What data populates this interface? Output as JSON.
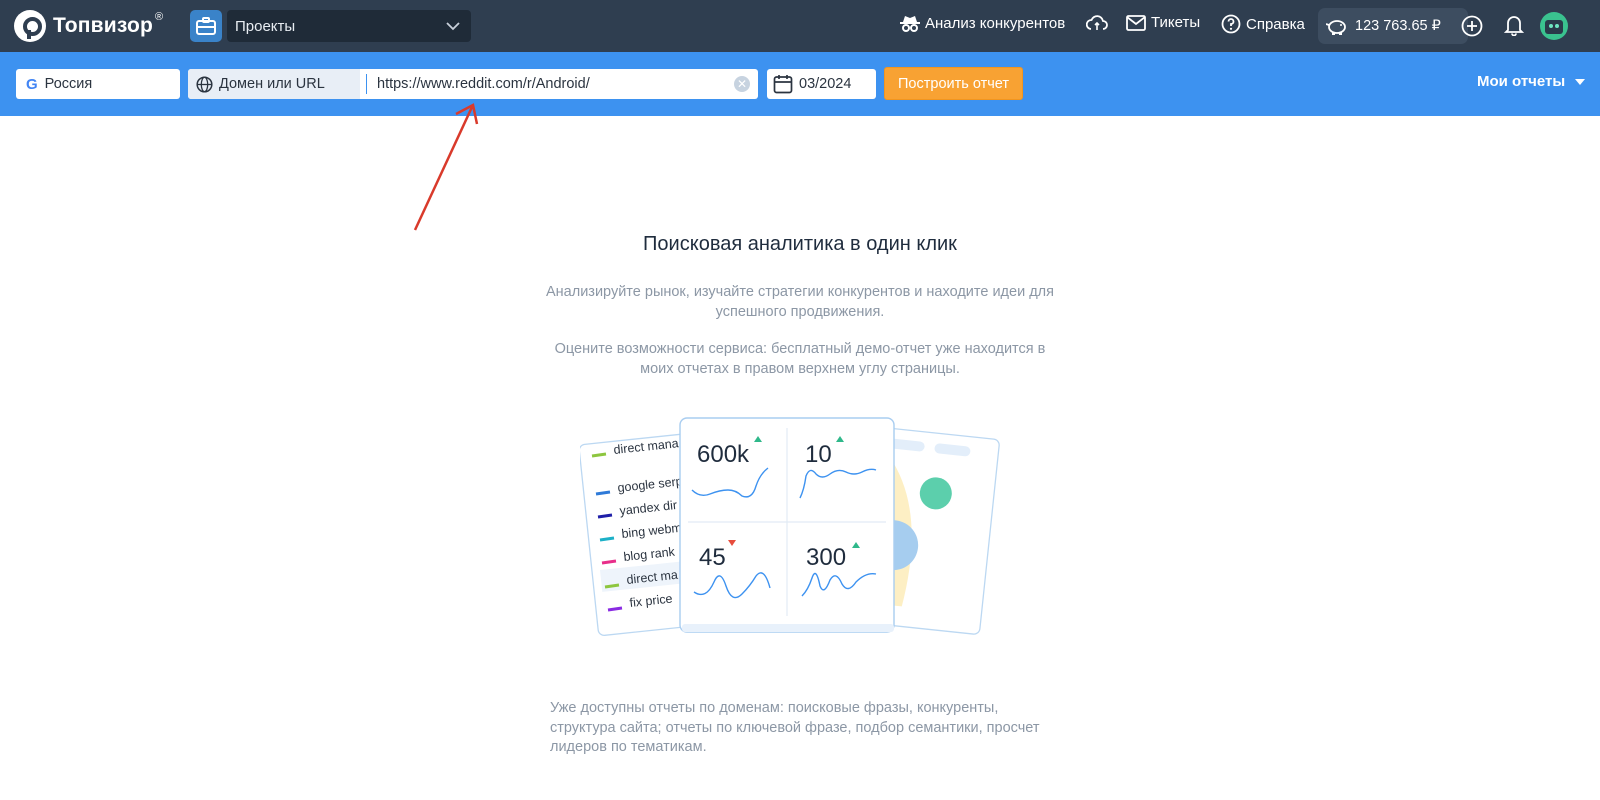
{
  "app": {
    "brand": "Топвизор",
    "brand_mark": "®",
    "brand_icon": "topvisor-logo-icon"
  },
  "nav": {
    "projects_label": "Проекты",
    "competitors": "Анализ конкурентов",
    "tickets": "Тикеты",
    "help": "Справка",
    "balance": "123 763.65 ₽"
  },
  "search": {
    "region": "Россия",
    "engine_icon": "google-icon",
    "type_label": "Домен или URL",
    "url_value": "https://www.reddit.com/r/Android/",
    "date": "03/2024",
    "build_button": "Построить отчет",
    "my_reports": "Мои отчеты"
  },
  "main": {
    "headline": "Поисковая аналитика в один клик",
    "desc1": "Анализируйте рынок, изучайте стратегии конкурентов и находите идеи для успешного продвижения.",
    "desc2": "Оцените возможности сервиса: бесплатный демо-отчет уже находится в моих отчетах в правом верхнем углу страницы.",
    "bottom_note": "Уже доступны отчеты по доменам: поисковые фразы, конкуренты, структура сайта; отчеты по ключевой фразе, подбор семантики, просчет лидеров по тематикам."
  },
  "illustration": {
    "list_items": [
      "direct mana",
      "google serp",
      "yandex dir",
      "bing webm",
      "blog rank",
      "direct ma",
      "fix price"
    ],
    "metrics": [
      {
        "value": "600k",
        "trend": "up"
      },
      {
        "value": "10",
        "trend": "up"
      },
      {
        "value": "45",
        "trend": "down"
      },
      {
        "value": "300",
        "trend": "up"
      }
    ]
  },
  "colors": {
    "topbar": "#2f3e50",
    "searchbar": "#3d92f0",
    "accent_orange": "#f8a233",
    "annotation_arrow": "#d93a2b"
  }
}
